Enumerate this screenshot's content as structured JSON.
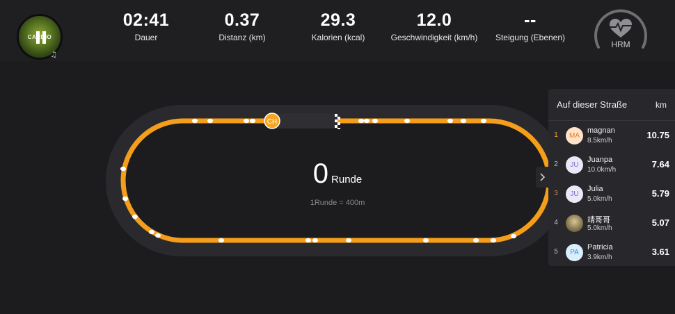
{
  "player": {
    "album_text": "CARDIO",
    "state_icon": "pause-icon",
    "music_icon": "♫"
  },
  "stats": [
    {
      "value": "02:41",
      "label": "Dauer"
    },
    {
      "value": "0.37",
      "label": "Distanz (km)"
    },
    {
      "value": "29.3",
      "label": "Kalorien (kcal)"
    },
    {
      "value": "12.0",
      "label": "Geschwindigkeit (km/h)"
    },
    {
      "value": "--",
      "label": "Steigung (Ebenen)"
    }
  ],
  "hrm": {
    "label": "HRM",
    "icon": "heart-pulse-icon"
  },
  "track": {
    "laps": "0",
    "laps_unit": "Runde",
    "lap_note": "1Runde = 400m",
    "marker_label": "CH",
    "colors": {
      "lane": "#f59e1b",
      "marker": "#f6a623"
    }
  },
  "leaderboard": {
    "title": "Auf dieser Straße",
    "unit": "km",
    "rows": [
      {
        "rank": "1",
        "initials": "MA",
        "name": "magnan",
        "speed": "8.5km/h",
        "km": "10.75",
        "avatar_bg": "#ffe3c9",
        "avatar_fg": "#e07b24",
        "rank_color": "#f6a623"
      },
      {
        "rank": "2",
        "initials": "JU",
        "name": "Juanpa",
        "speed": "10.0km/h",
        "km": "7.64",
        "avatar_bg": "#ece8f8",
        "avatar_fg": "#7a6cc8",
        "rank_color": "#bdbdbd"
      },
      {
        "rank": "3",
        "initials": "JU",
        "name": "Julia",
        "speed": "5.0km/h",
        "km": "5.79",
        "avatar_bg": "#ece8f8",
        "avatar_fg": "#7a6cc8",
        "rank_color": "#c9865a"
      },
      {
        "rank": "4",
        "initials": "",
        "name": "靖哥哥",
        "speed": "5.0km/h",
        "km": "5.07",
        "avatar_bg": "#8a7a50",
        "avatar_fg": "#ffffff",
        "rank_color": "#bdbdbd"
      },
      {
        "rank": "5",
        "initials": "PA",
        "name": "Patricia",
        "speed": "3.9km/h",
        "km": "3.61",
        "avatar_bg": "#dbeefc",
        "avatar_fg": "#3d8fd6",
        "rank_color": "#bdbdbd"
      }
    ]
  }
}
